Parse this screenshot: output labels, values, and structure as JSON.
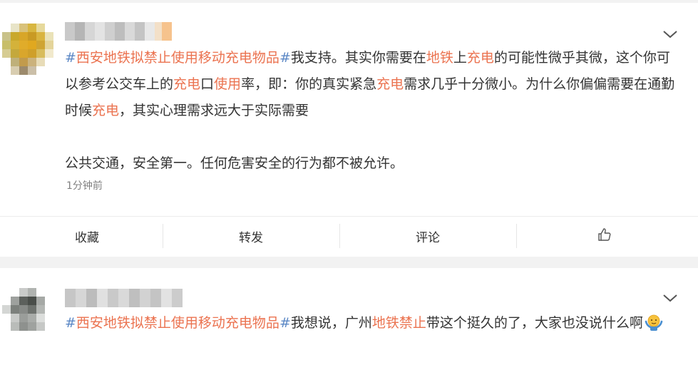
{
  "posts": [
    {
      "segments": [
        {
          "text": "#",
          "style": "hash"
        },
        {
          "text": "西安地铁拟禁止使用移动充电物品",
          "style": "tag"
        },
        {
          "text": "#",
          "style": "hash"
        },
        {
          "text": "我支持。其实你需要在",
          "style": "t"
        },
        {
          "text": "地铁",
          "style": "kw"
        },
        {
          "text": "上",
          "style": "t"
        },
        {
          "text": "充电",
          "style": "kw"
        },
        {
          "text": "的可能性微乎其微，这个你可以参考公交车上的",
          "style": "t"
        },
        {
          "text": "充电",
          "style": "kw"
        },
        {
          "text": "口",
          "style": "t"
        },
        {
          "text": "使用",
          "style": "kw"
        },
        {
          "text": "率，即：你的真实紧急",
          "style": "t"
        },
        {
          "text": "充电",
          "style": "kw"
        },
        {
          "text": "需求几乎十分微小。为什么你偏偏需要在通勤时候",
          "style": "t"
        },
        {
          "text": "充电",
          "style": "kw"
        },
        {
          "text": "，其实心理需求远大于实际需要",
          "style": "t"
        }
      ],
      "paragraph2": "公共交通，安全第一。任何危害安全的行为都不被允许。",
      "time": "1分钟前",
      "actions": {
        "favorite": "收藏",
        "repost": "转发",
        "comment": "评论",
        "like_icon": "thumbs-up-icon"
      }
    },
    {
      "segments": [
        {
          "text": "#",
          "style": "hash"
        },
        {
          "text": "西安地铁拟禁止使用移动充电物品",
          "style": "tag"
        },
        {
          "text": "#",
          "style": "hash"
        },
        {
          "text": "我想说，广州",
          "style": "t"
        },
        {
          "text": "地铁禁止",
          "style": "kw"
        },
        {
          "text": "带这个挺久的了，大家也没说什么啊",
          "style": "t"
        }
      ],
      "emoji": "shrug-emoji-icon"
    }
  ],
  "colors": {
    "topic": "#eb7350",
    "hash": "#5d89c6",
    "text": "#333333",
    "time": "#808080"
  }
}
